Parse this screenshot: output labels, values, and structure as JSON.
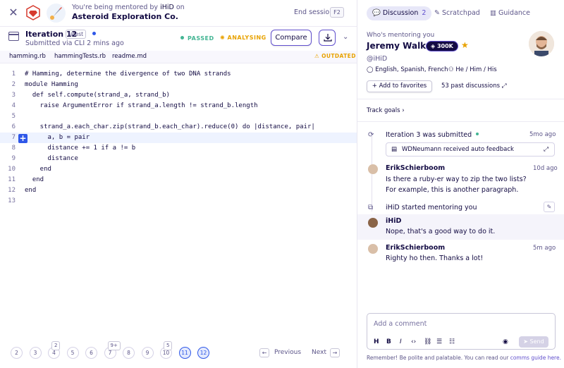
{
  "header": {
    "mentored_prefix": "You're being mentored by",
    "mentor_handle": "iHiD",
    "mentored_suffix": "on",
    "exercise_title": "Asteroid Exploration Co.",
    "end_session_label": "End session",
    "end_session_key": "F2"
  },
  "iteration": {
    "title": "Iteration 12",
    "latest_badge": "latest",
    "submitted": "Submitted via CLI 2 mins ago",
    "status_passed": "PASSED",
    "status_analysing": "ANALYSING",
    "compare_label": "Compare"
  },
  "files": {
    "tabs": [
      "hamming.rb",
      "hammingTests.rb",
      "readme.md"
    ],
    "outdated_label": "OUTDATED"
  },
  "code": {
    "lines": [
      {
        "n": "1",
        "t": "# Hamming, determine the divergence of two DNA strands"
      },
      {
        "n": "2",
        "t": "module Hamming"
      },
      {
        "n": "3",
        "t": "  def self.compute(strand_a, strand_b)"
      },
      {
        "n": "4",
        "t": "    raise ArgumentError if strand_a.length != strand_b.length"
      },
      {
        "n": "5",
        "t": ""
      },
      {
        "n": "6",
        "t": "    strand_a.each_char.zip(strand_b.each_char).reduce(0) do |distance, pair|"
      },
      {
        "n": "7",
        "t": "      a, b = pair"
      },
      {
        "n": "8",
        "t": "      distance += 1 if a != b"
      },
      {
        "n": "9",
        "t": "      distance"
      },
      {
        "n": "10",
        "t": "    end"
      },
      {
        "n": "11",
        "t": "  end"
      },
      {
        "n": "12",
        "t": "end"
      },
      {
        "n": "13",
        "t": ""
      }
    ]
  },
  "pagination": {
    "pages": [
      "2",
      "3",
      "4",
      "5",
      "6",
      "7",
      "8",
      "9",
      "10",
      "11",
      "12"
    ],
    "badges": {
      "4": "2",
      "7": "9+",
      "10": "5"
    },
    "current": [
      "11",
      "12"
    ],
    "prev_label": "Previous",
    "next_label": "Next"
  },
  "right": {
    "tabs": {
      "discussion": "Discussion",
      "discussion_count": "2",
      "scratchpad": "Scratchpad",
      "guidance": "Guidance"
    },
    "mentor": {
      "who_label": "Who's mentoring you",
      "name": "Jeremy Walker",
      "reputation": "300K",
      "handle": "@iHiD",
      "languages": "English, Spanish, French",
      "pronouns": "He / Him / His",
      "fav_label": "Add to favorites",
      "past_discussions": "53 past discussions"
    },
    "track_goals": "Track goals",
    "feed": {
      "iter_submitted_prefix": "Iteration",
      "iter_submitted_num": "3",
      "iter_submitted_suffix": "was submitted",
      "iter_time": "5mo ago",
      "auto_feedback": "WDNeumann received auto feedback",
      "post1_author": "ErikSchierboom",
      "post1_time": "10d ago",
      "post1_line1": "Is there a ruby-er way to zip the two lists?",
      "post1_line2": "For example, this is another paragraph.",
      "started": "iHiD started mentoring you",
      "post2_author": "iHiD",
      "post2_text": "Nope, that's a good way to do it.",
      "post3_author": "ErikSchierboom",
      "post3_time": "5m ago",
      "post3_text": "Righty ho then. Thanks a lot!"
    },
    "comment": {
      "placeholder": "Add a comment",
      "send_label": "Send",
      "remember": "Remember! Be polite and palatable. You can read our",
      "guide_link": "comms guide here."
    }
  },
  "colors": {
    "primary": "#604fcd",
    "blue": "#2e57e8",
    "passed": "#43b593",
    "warning": "#e8a200",
    "text": "#130b43"
  }
}
